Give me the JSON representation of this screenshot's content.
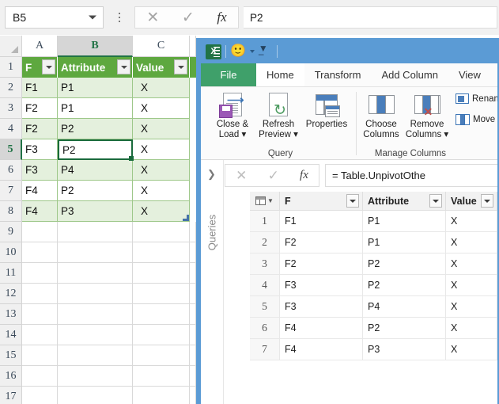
{
  "excel": {
    "name_box": {
      "value": "B5"
    },
    "formula_bar": {
      "value": "P2",
      "fx_label": "fx",
      "cancel_icon": "✕",
      "confirm_icon": "✓"
    },
    "column_headers": [
      "A",
      "B",
      "C"
    ],
    "selected_column": "B",
    "row_headers": [
      "1",
      "2",
      "3",
      "4",
      "5",
      "6",
      "7",
      "8",
      "9",
      "10",
      "11",
      "12",
      "13",
      "14",
      "15",
      "16",
      "17"
    ],
    "selected_row": "5",
    "table": {
      "headers": [
        "F",
        "Attribute",
        "Value"
      ],
      "rows": [
        [
          "F1",
          "P1",
          "X"
        ],
        [
          "F2",
          "P1",
          "X"
        ],
        [
          "F2",
          "P2",
          "X"
        ],
        [
          "F3",
          "P2",
          "X"
        ],
        [
          "F3",
          "P4",
          "X"
        ],
        [
          "F4",
          "P2",
          "X"
        ],
        [
          "F4",
          "P3",
          "X"
        ]
      ]
    },
    "active_cell": {
      "address": "B5",
      "value": "P2"
    },
    "colors": {
      "table_header_bg": "#5ea83f",
      "band_bg": "#e4f0dd",
      "accent": "#217346"
    }
  },
  "power_query": {
    "title_bar": {
      "app_icon": "excel-icon",
      "qat_icons": [
        "smiley-icon",
        "qat-dropdown-icon"
      ]
    },
    "tabs": [
      {
        "label": "File",
        "active": false,
        "is_file": true
      },
      {
        "label": "Home",
        "active": true,
        "is_file": false
      },
      {
        "label": "Transform",
        "active": false,
        "is_file": false
      },
      {
        "label": "Add Column",
        "active": false,
        "is_file": false
      },
      {
        "label": "View",
        "active": false,
        "is_file": false
      }
    ],
    "ribbon": {
      "groups": [
        {
          "name": "Query",
          "buttons": [
            {
              "line1": "Close &",
              "line2": "Load",
              "has_dropdown": true,
              "icon": "close-and-load-icon"
            },
            {
              "line1": "Refresh",
              "line2": "Preview",
              "has_dropdown": true,
              "icon": "refresh-preview-icon"
            },
            {
              "line1": "Properties",
              "line2": "",
              "has_dropdown": false,
              "icon": "properties-icon"
            }
          ]
        },
        {
          "name": "Manage Columns",
          "buttons": [
            {
              "line1": "Choose",
              "line2": "Columns",
              "has_dropdown": false,
              "icon": "choose-columns-icon"
            },
            {
              "line1": "Remove",
              "line2": "Columns",
              "has_dropdown": true,
              "icon": "remove-columns-icon"
            }
          ],
          "small_buttons": [
            {
              "label": "Rename",
              "icon": "rename-column-icon"
            },
            {
              "label": "Move",
              "icon": "move-column-icon"
            }
          ]
        }
      ]
    },
    "formula_bar": {
      "expander_icon": "chevron-right-icon",
      "cancel_icon": "✕",
      "confirm_icon": "✓",
      "fx_label": "fx",
      "value": "= Table.UnpivotOthe"
    },
    "queries_pane": {
      "label": "Queries"
    },
    "preview": {
      "headers": [
        "F",
        "Attribute",
        "Value"
      ],
      "rows": [
        {
          "index": "1",
          "cells": [
            "F1",
            "P1",
            "X"
          ]
        },
        {
          "index": "2",
          "cells": [
            "F2",
            "P1",
            "X"
          ]
        },
        {
          "index": "3",
          "cells": [
            "F2",
            "P2",
            "X"
          ]
        },
        {
          "index": "4",
          "cells": [
            "F3",
            "P2",
            "X"
          ]
        },
        {
          "index": "5",
          "cells": [
            "F3",
            "P4",
            "X"
          ]
        },
        {
          "index": "6",
          "cells": [
            "F4",
            "P2",
            "X"
          ]
        },
        {
          "index": "7",
          "cells": [
            "F4",
            "P3",
            "X"
          ]
        }
      ]
    },
    "colors": {
      "title_bar": "#5b9bd5",
      "file_tab": "#3fa06a"
    }
  }
}
